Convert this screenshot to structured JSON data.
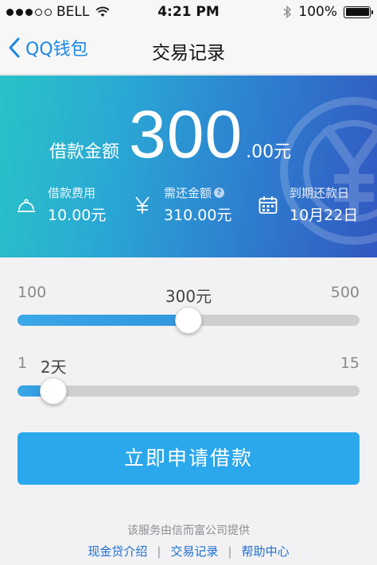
{
  "status_bar": {
    "carrier": "BELL",
    "time": "4:21 PM",
    "battery": "100%",
    "signal_bars_filled": 3,
    "signal_bars_total": 5
  },
  "nav": {
    "back_label": "QQ钱包",
    "title": "交易记录"
  },
  "banner": {
    "amount_label": "借款金额",
    "amount_main": "300",
    "amount_suffix": ".00元",
    "info": [
      {
        "icon": "bell-icon",
        "label": "借款费用",
        "value": "10.00元"
      },
      {
        "icon": "yen-icon",
        "label": "需还金额",
        "value": "310.00元",
        "help": "?"
      },
      {
        "icon": "calendar-icon",
        "label": "到期还款日",
        "value": "10月22日"
      }
    ]
  },
  "amount_slider": {
    "min_label": "100",
    "max_label": "500",
    "current_label": "300元",
    "min": 100,
    "max": 500,
    "value": 300
  },
  "days_slider": {
    "min_label": "1",
    "max_label": "15",
    "current_label": "2天",
    "min": 1,
    "max": 15,
    "value": 2
  },
  "apply_button": "立即申请借款",
  "footer": {
    "note": "该服务由信而富公司提供",
    "links": [
      "现金贷介绍",
      "交易记录",
      "帮助中心"
    ],
    "separator": "|"
  },
  "colors": {
    "accent": "#2ba7ec",
    "link": "#1e6fd0",
    "banner_start": "#28c3c7",
    "banner_end": "#3258c1"
  }
}
